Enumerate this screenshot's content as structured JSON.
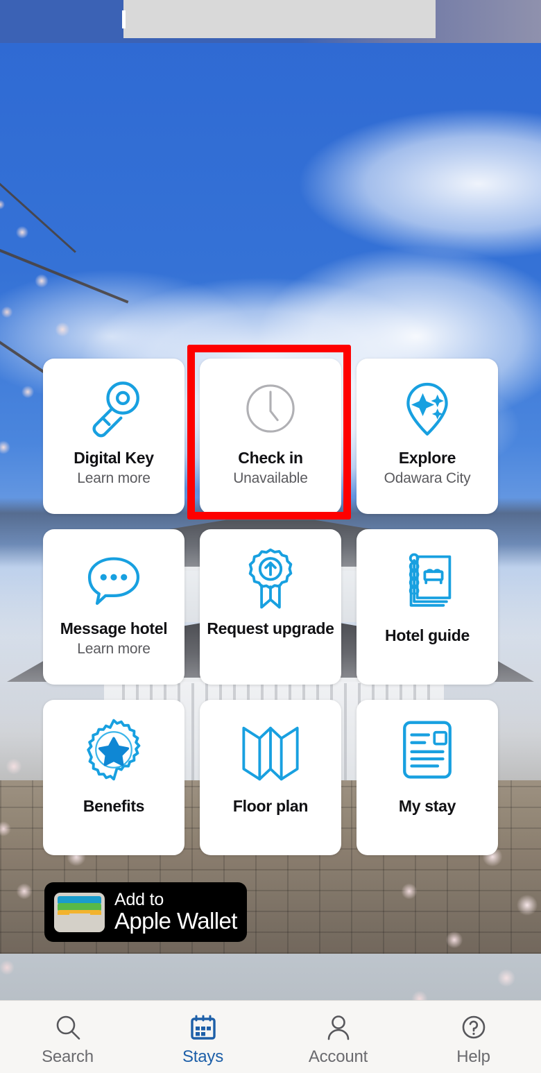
{
  "browser_band": {
    "name": "browser-chrome-band",
    "accent": "#3b62b5",
    "sheet_color": "#d9d9d9"
  },
  "background": {
    "description": "Odawara Castle with blue sky, clouds and cherry blossoms",
    "sky_color": "#2f6ad3"
  },
  "theme": {
    "icon_blue": "#18a0e0",
    "disabled_gray": "#b0b0b4",
    "highlight_red": "#fe0000",
    "active_tab_blue": "#1d5fa8",
    "card_background": "#ffffff"
  },
  "cards": [
    {
      "id": "digital-key",
      "title": "Digital Key",
      "subtitle": "Learn more",
      "icon": "key-icon",
      "state": "enabled",
      "highlighted": false
    },
    {
      "id": "check-in",
      "title": "Check in",
      "subtitle": "Unavailable",
      "icon": "clock-icon",
      "state": "disabled",
      "highlighted": true
    },
    {
      "id": "explore",
      "title": "Explore",
      "subtitle": "Odawara City",
      "icon": "sparkle-pin-icon",
      "state": "enabled",
      "highlighted": false
    },
    {
      "id": "message-hotel",
      "title": "Message hotel",
      "subtitle": "Learn more",
      "icon": "chat-bubble-icon",
      "state": "enabled",
      "highlighted": false
    },
    {
      "id": "request-upgrade",
      "title": "Request upgrade",
      "subtitle": "",
      "icon": "award-ribbon-up-arrow-icon",
      "state": "enabled",
      "highlighted": false
    },
    {
      "id": "hotel-guide",
      "title": "Hotel guide",
      "subtitle": "",
      "icon": "spiral-notebook-bed-icon",
      "state": "enabled",
      "highlighted": false
    },
    {
      "id": "benefits",
      "title": "Benefits",
      "subtitle": "",
      "icon": "star-badge-icon",
      "state": "enabled",
      "highlighted": false
    },
    {
      "id": "floor-plan",
      "title": "Floor plan",
      "subtitle": "",
      "icon": "folded-map-icon",
      "state": "enabled",
      "highlighted": false
    },
    {
      "id": "my-stay",
      "title": "My stay",
      "subtitle": "",
      "icon": "document-lines-icon",
      "state": "enabled",
      "highlighted": false
    }
  ],
  "wallet_button": {
    "line1": "Add to",
    "line2": "Apple Wallet",
    "icon": "apple-wallet-icon"
  },
  "tabbar": {
    "items": [
      {
        "id": "search",
        "label": "Search",
        "icon": "magnifier-icon",
        "active": false
      },
      {
        "id": "stays",
        "label": "Stays",
        "icon": "calendar-icon",
        "active": true
      },
      {
        "id": "account",
        "label": "Account",
        "icon": "person-icon",
        "active": false
      },
      {
        "id": "help",
        "label": "Help",
        "icon": "question-circle-icon",
        "active": false
      }
    ]
  }
}
